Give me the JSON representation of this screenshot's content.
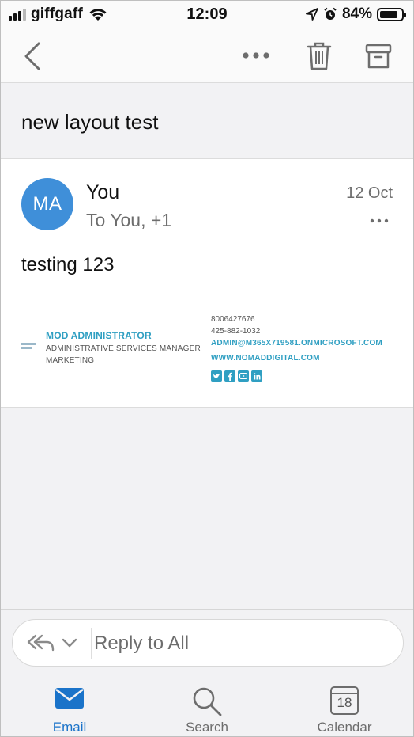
{
  "status_bar": {
    "carrier": "giffgaff",
    "time": "12:09",
    "battery_percent": "84%",
    "battery_level": 0.84,
    "signal_bars_filled": 3,
    "icons": [
      "signal-icon",
      "wifi-icon",
      "location-arrow-icon",
      "alarm-icon",
      "battery-icon"
    ]
  },
  "toolbar": {
    "icons": [
      "back-chevron-icon",
      "more-dots-icon",
      "trash-icon",
      "archive-icon"
    ]
  },
  "email": {
    "subject": "new layout test",
    "avatar_initials": "MA",
    "avatar_color": "#3f8fd9",
    "sender": "You",
    "recipients": "To You, +1",
    "date": "12 Oct",
    "body": "testing 123",
    "signature": {
      "name": "MOD ADMINISTRATOR",
      "title": "ADMINISTRATIVE SERVICES MANAGER",
      "department": "MARKETING",
      "phone1": "8006427676",
      "phone2": "425-882-1032",
      "email": "ADMIN@M365X719581.ONMICROSOFT.COM",
      "website": "WWW.NOMADDIGITAL.COM",
      "social_icons": [
        "twitter-icon",
        "facebook-icon",
        "youtube-icon",
        "linkedin-icon"
      ],
      "accent_color": "#2f9fc2"
    }
  },
  "reply": {
    "placeholder": "Reply to All",
    "icons": [
      "reply-all-icon",
      "chevron-down-icon"
    ]
  },
  "tabs": [
    {
      "label": "Email",
      "icon": "mail-icon",
      "active": true
    },
    {
      "label": "Search",
      "icon": "search-icon",
      "active": false
    },
    {
      "label": "Calendar",
      "icon": "calendar-icon",
      "active": false,
      "badge": "18"
    }
  ],
  "colors": {
    "accent": "#1a73c9",
    "background": "#f2f2f4",
    "secondary_text": "#6d6d6d"
  }
}
